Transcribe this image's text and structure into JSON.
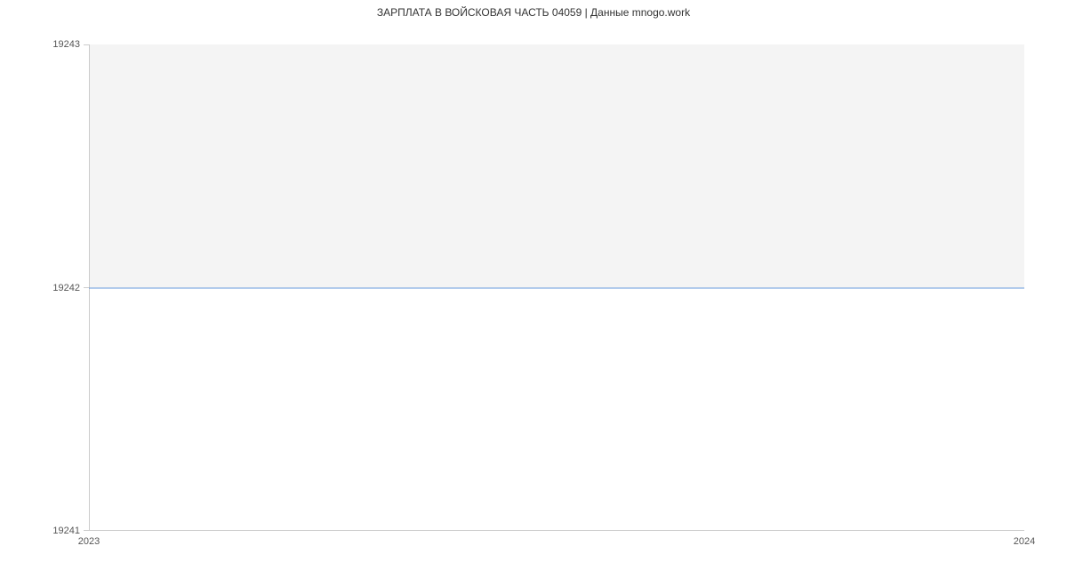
{
  "chart_data": {
    "type": "line",
    "title": "ЗАРПЛАТА В ВОЙСКОВАЯ ЧАСТЬ 04059 | Данные mnogo.work",
    "xlabel": "",
    "ylabel": "",
    "x": [
      2023,
      2024
    ],
    "y": [
      19242,
      19242
    ],
    "x_ticks": [
      "2023",
      "2024"
    ],
    "y_ticks": [
      "19241",
      "19242",
      "19243"
    ],
    "xlim": [
      2023,
      2024
    ],
    "ylim": [
      19241,
      19243
    ],
    "series_color": "#6699dd",
    "shaded_band": true
  }
}
